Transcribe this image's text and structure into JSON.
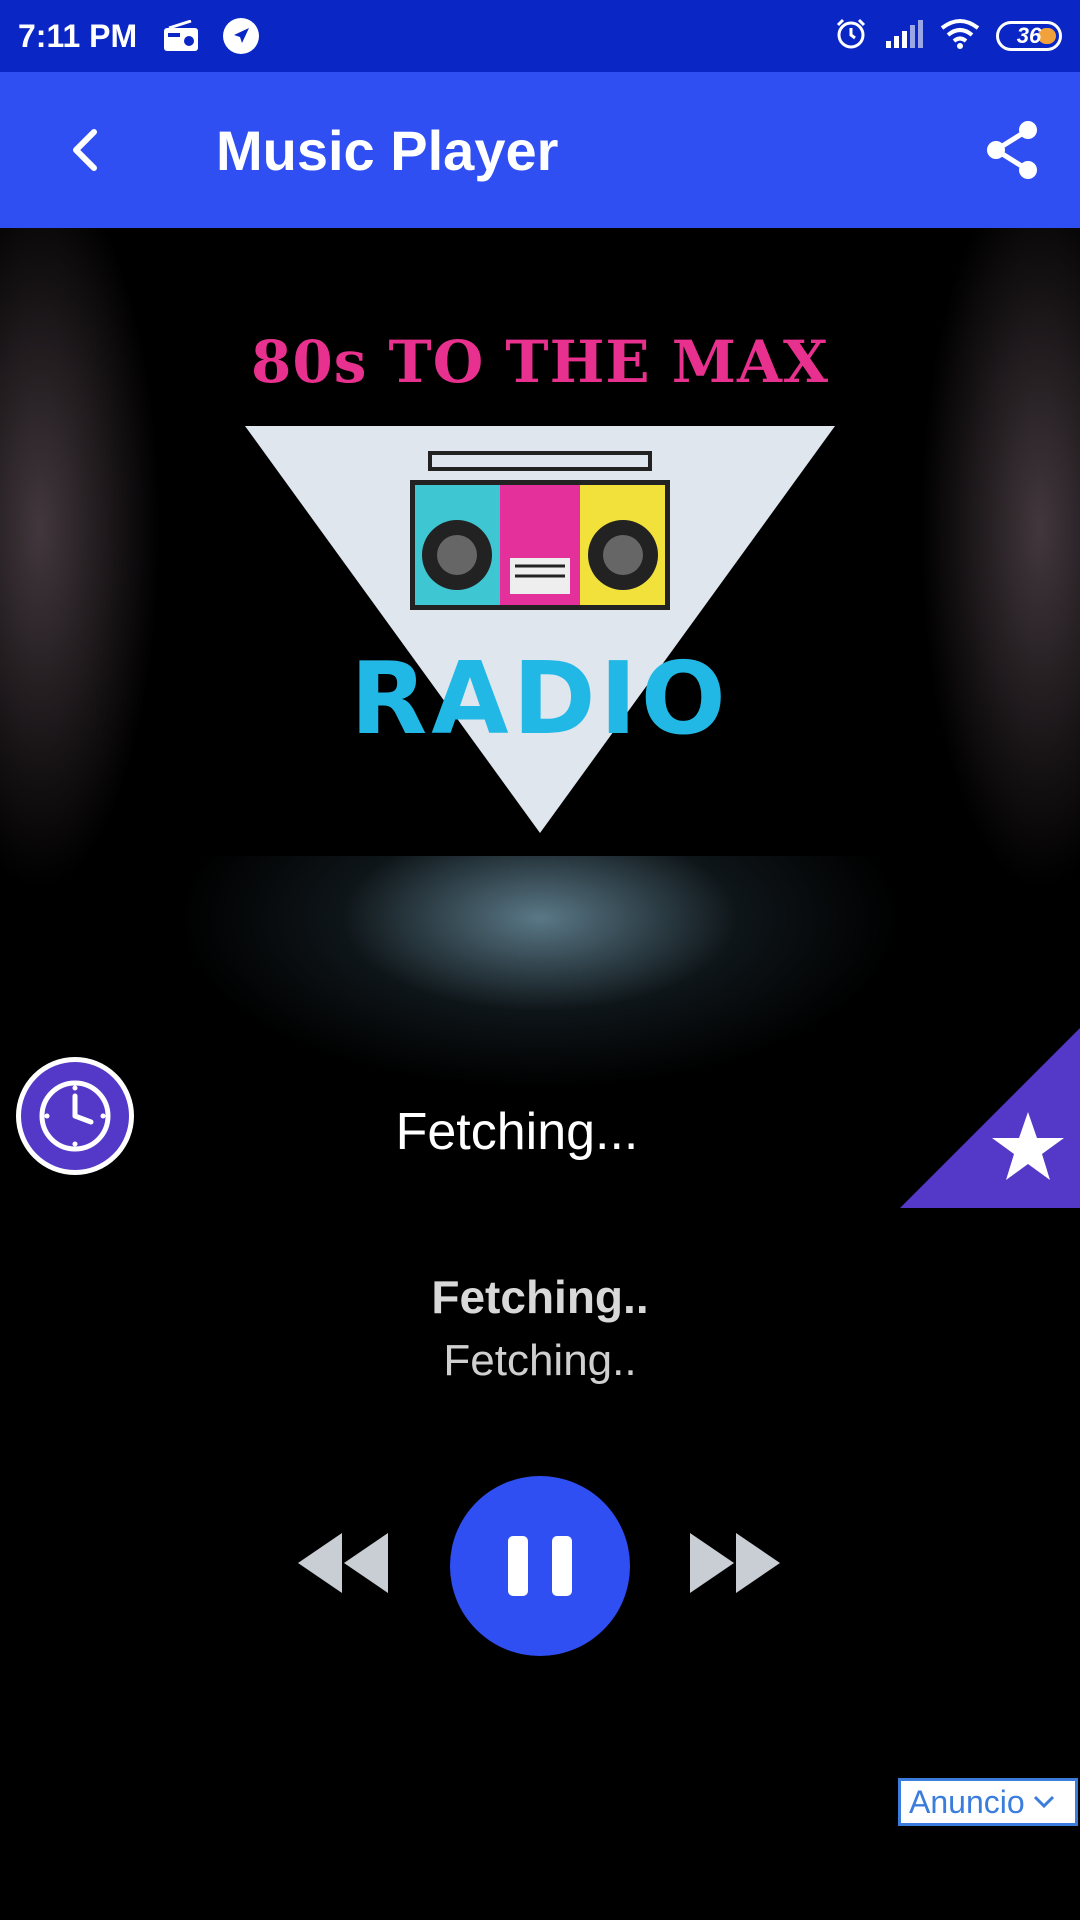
{
  "status_bar": {
    "time": "7:11 PM",
    "battery_level": "36",
    "icons": [
      "radio-icon",
      "navigation-icon",
      "alarm-icon",
      "signal-icon",
      "wifi-icon",
      "battery-icon"
    ]
  },
  "app_bar": {
    "title": "Music Player",
    "back_icon": "chevron-left-icon",
    "share_icon": "share-icon"
  },
  "artwork": {
    "top_text": "80s TO THE MAX",
    "bottom_text": "RADIO"
  },
  "player": {
    "status_text": "Fetching...",
    "song_title": "Fetching..",
    "song_artist": "Fetching.."
  },
  "controls": {
    "prev_icon": "rewind-icon",
    "play_icon": "pause-icon",
    "next_icon": "fast-forward-icon"
  },
  "ad": {
    "label": "Anuncio"
  },
  "colors": {
    "status_bar": "#0a26c4",
    "app_bar": "#2f4ff2",
    "accent_purple": "#5438c8",
    "play_button": "#2f4ff2"
  }
}
